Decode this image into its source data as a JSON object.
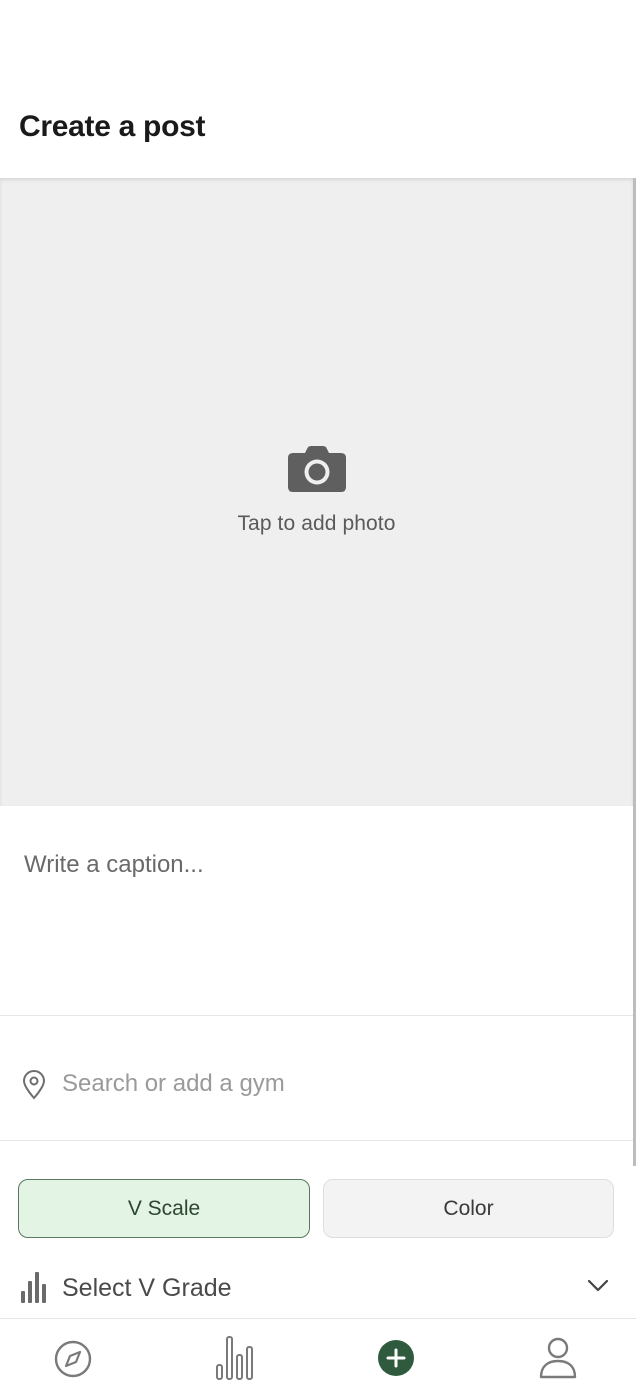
{
  "header": {
    "title": "Create a post"
  },
  "photo": {
    "label": "Tap to add photo",
    "icon": "camera-icon"
  },
  "caption": {
    "placeholder": "Write a caption..."
  },
  "gym": {
    "placeholder": "Search or add a gym",
    "icon": "map-pin-icon"
  },
  "grade_system": {
    "options": [
      {
        "label": "V Scale",
        "selected": true
      },
      {
        "label": "Color",
        "selected": false
      }
    ]
  },
  "grade_select": {
    "label": "Select V Grade",
    "icon": "bar-chart-icon"
  },
  "bottom_nav": {
    "items": [
      {
        "name": "explore",
        "icon": "compass-icon"
      },
      {
        "name": "stats",
        "icon": "bar-chart-icon"
      },
      {
        "name": "create",
        "icon": "plus-circle-icon",
        "active": true
      },
      {
        "name": "profile",
        "icon": "person-icon"
      }
    ]
  },
  "colors": {
    "accent": "#2f5a3e",
    "selected_bg": "#e3f3e4",
    "photo_bg": "#efefef"
  }
}
